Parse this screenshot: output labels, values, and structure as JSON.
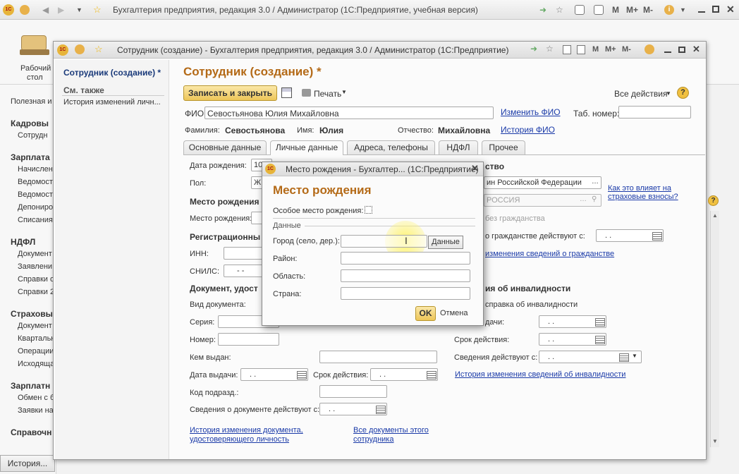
{
  "app": {
    "title": "Бухгалтерия предприятия, редакция 3.0 / Администратор  (1С:Предприятие, учебная версия)",
    "toolbar_right": [
      "M",
      "M+",
      "M-"
    ]
  },
  "iconbar": {
    "desktop_label_1": "Рабочий",
    "desktop_label_2": "стол"
  },
  "leftnav": {
    "items": [
      {
        "type": "plain",
        "label": "Полезная и"
      },
      {
        "type": "header",
        "label": "Кадровы"
      },
      {
        "type": "item",
        "label": "Сотрудн"
      },
      {
        "type": "header",
        "label": "Зарплата"
      },
      {
        "type": "item",
        "label": "Начислен"
      },
      {
        "type": "item",
        "label": "Ведомост"
      },
      {
        "type": "item",
        "label": "Ведомост"
      },
      {
        "type": "item",
        "label": "Депониро"
      },
      {
        "type": "item",
        "label": "Списания"
      },
      {
        "type": "header",
        "label": "НДФЛ"
      },
      {
        "type": "item",
        "label": "Документ"
      },
      {
        "type": "item",
        "label": "Заявлени"
      },
      {
        "type": "item",
        "label": "Справки о"
      },
      {
        "type": "item",
        "label": "Справки 2"
      },
      {
        "type": "header",
        "label": "Страховы"
      },
      {
        "type": "item",
        "label": "Документ"
      },
      {
        "type": "item",
        "label": "Квартальн"
      },
      {
        "type": "item",
        "label": "Операции"
      },
      {
        "type": "item",
        "label": "Исходяща"
      },
      {
        "type": "header",
        "label": "Зарплатн"
      },
      {
        "type": "item",
        "label": "Обмен с б"
      },
      {
        "type": "item",
        "label": "Заявки на"
      },
      {
        "type": "header",
        "label": "Справочн"
      }
    ],
    "history_button": "История..."
  },
  "employee_window": {
    "title": "Сотрудник (создание) - Бухгалтерия предприятия, редакция 3.0 / Администратор  (1С:Предприятие)",
    "side": {
      "current": "Сотрудник (создание) *",
      "see_also": "См. также",
      "history_link": "История изменений личн..."
    },
    "form_title": "Сотрудник (создание) *",
    "toolbar": {
      "save_close": "Записать и закрыть",
      "print": "Печать",
      "all_actions": "Все действия",
      "help": "?"
    },
    "fio_label": "ФИО:",
    "fio_value": "Севостьянова Юлия Михайловна",
    "change_fio": "Изменить ФИО",
    "tab_number_label": "Таб. номер:",
    "tab_number_value": "",
    "surname_label": "Фамилия:",
    "surname_value": "Севостьянова",
    "name_label": "Имя:",
    "name_value": "Юлия",
    "patronymic_label": "Отчество:",
    "patronymic_value": "Михайловна",
    "fio_history": "История ФИО",
    "tabs": [
      "Основные данные",
      "Личные данные",
      "Адреса, телефоны",
      "НДФЛ",
      "Прочее"
    ],
    "active_tab": 1,
    "personal": {
      "birthdate_label": "Дата рождения:",
      "birthdate_value": "10",
      "gender_label": "Пол:",
      "gender_value": "Ж",
      "birthplace_section": "Место рождения",
      "birthplace_label": "Место рождения:",
      "reg_section": "Регистрационны",
      "inn_label": "ИНН:",
      "snils_label": "СНИЛС:",
      "snils_value": "-   -",
      "doc_section": "Документ, удост",
      "doc_type_label": "Вид документа:",
      "series_label": "Серия:",
      "number_label": "Номер:",
      "issued_by_label": "Кем выдан:",
      "issue_date_label": "Дата выдачи:",
      "issue_date_value": ".   .",
      "validity_label": "Срок действия:",
      "validity_value": ".   .",
      "dept_code_label": "Код подразд.:",
      "doc_valid_from_label": "Сведения о документе действуют с:",
      "doc_valid_from_value": ".   .",
      "doc_history_link_1": "История изменения документа,",
      "doc_history_link_2": "удостоверяющего личность",
      "all_docs_link_1": "Все документы этого",
      "all_docs_link_2": "сотрудника",
      "citizenship_section_tail": "ство",
      "country_value": "ин Российской Федерации",
      "how_affects_1": "Как это влияет на",
      "how_affects_2": "страховые взносы?",
      "country_gray": "РОССИЯ",
      "stateless_label": "без гражданства",
      "citizenship_from_label": "о гражданстве действуют с:",
      "citizenship_from_value": ".   .",
      "citizenship_history": "изменения сведений о гражданстве",
      "disability_section": "ия об инвалидности",
      "disability_cert": "справка об инвалидности",
      "disability_issue_label": "дачи:",
      "disability_issue_value": ".   .",
      "disability_validity_label": "Срок действия:",
      "disability_validity_value": ".   .",
      "disability_from_label": "Сведения действуют с:",
      "disability_from_value": ".   .",
      "disability_history": "История изменения сведений об инвалидности"
    }
  },
  "modal": {
    "title": "Место рождения - Бухгалтер...  (1С:Предприятие)",
    "heading": "Место рождения",
    "special_label": "Особое место рождения:",
    "data_group": "Данные",
    "city_label": "Город (село, дер.):",
    "data_button": "Данные",
    "district_label": "Район:",
    "region_label": "Область:",
    "country_label": "Страна:",
    "ok": "OK",
    "cancel": "Отмена"
  },
  "colors": {
    "accent": "#e7b43a",
    "link": "#1a3aa8",
    "title_orange": "#b46a17",
    "cursor_highlight": "#fff36a"
  }
}
